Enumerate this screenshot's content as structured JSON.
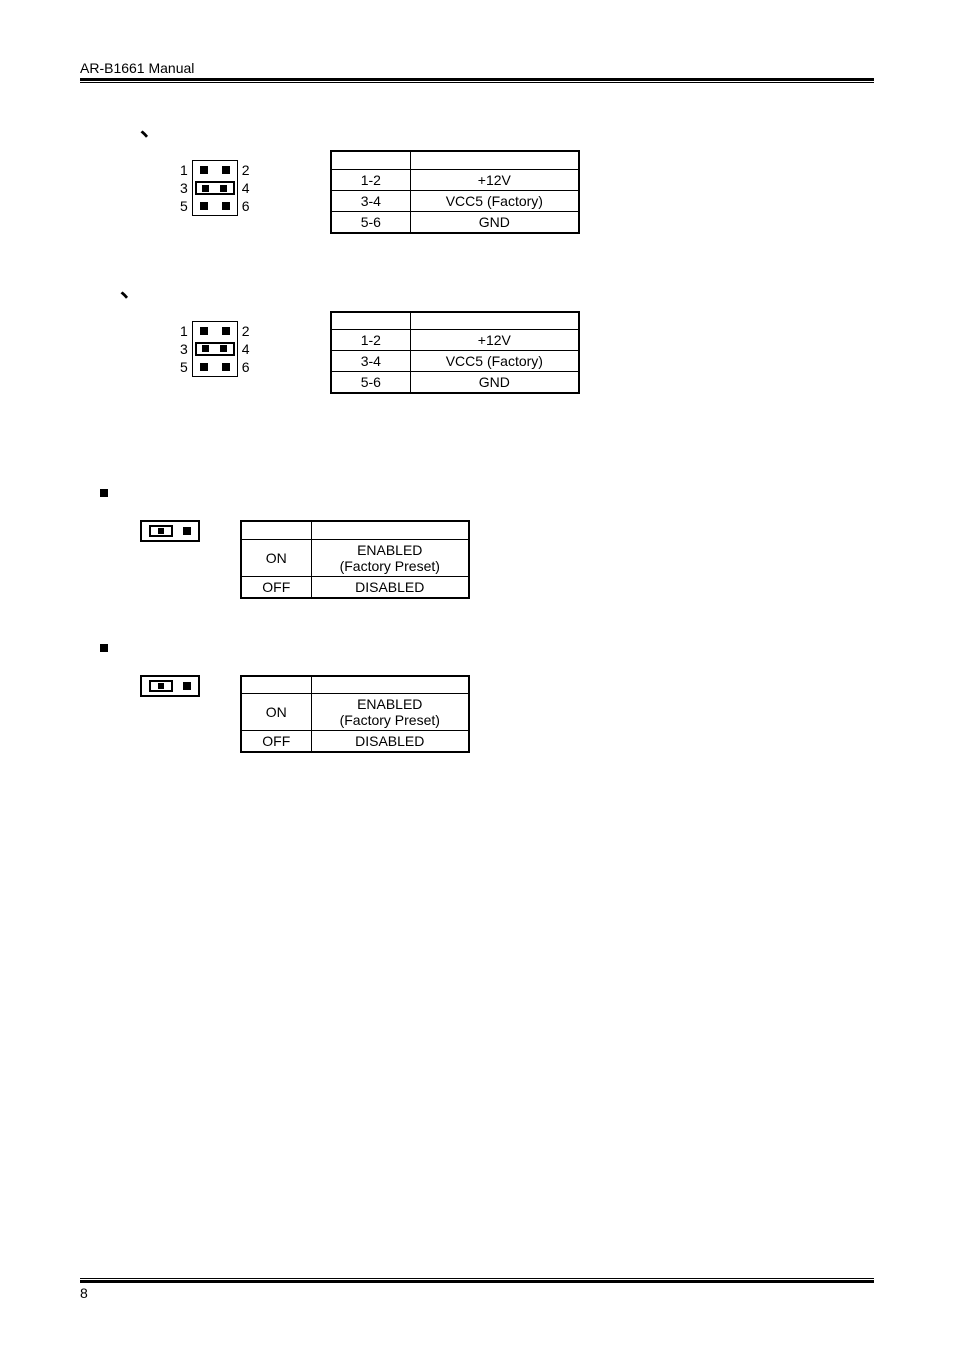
{
  "header": {
    "title": "AR-B1661 Manual"
  },
  "jp_a": {
    "left": [
      "1",
      "3",
      "5"
    ],
    "right": [
      "2",
      "4",
      "6"
    ],
    "rows": [
      {
        "c1": "1-2",
        "c2": "+12V"
      },
      {
        "c1": "3-4",
        "c2": "VCC5 (Factory)"
      },
      {
        "c1": "5-6",
        "c2": "GND"
      }
    ]
  },
  "jp_b": {
    "left": [
      "1",
      "3",
      "5"
    ],
    "right": [
      "2",
      "4",
      "6"
    ],
    "rows": [
      {
        "c1": "1-2",
        "c2": "+12V"
      },
      {
        "c1": "3-4",
        "c2": "VCC5 (Factory)"
      },
      {
        "c1": "5-6",
        "c2": "GND"
      }
    ]
  },
  "jp_c": {
    "rows": [
      {
        "c1": "ON",
        "c2a": "ENABLED",
        "c2b": "(Factory Preset)"
      },
      {
        "c1": "OFF",
        "c2a": "DISABLED"
      }
    ]
  },
  "jp_d": {
    "rows": [
      {
        "c1": "ON",
        "c2a": "ENABLED",
        "c2b": "(Factory Preset)"
      },
      {
        "c1": "OFF",
        "c2a": "DISABLED"
      }
    ]
  },
  "footer": {
    "page": "8"
  }
}
